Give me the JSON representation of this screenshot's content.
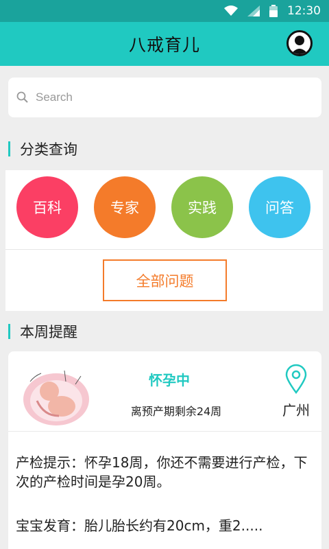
{
  "status_bar": {
    "time": "12:30"
  },
  "app_bar": {
    "title": "八戒育儿"
  },
  "search": {
    "placeholder": "Search"
  },
  "categories": {
    "header": "分类查询",
    "items": [
      {
        "label": "百科",
        "color": "#fb3f64"
      },
      {
        "label": "专家",
        "color": "#f47b2a"
      },
      {
        "label": "实践",
        "color": "#8bc34a"
      },
      {
        "label": "问答",
        "color": "#3ec3ee"
      }
    ],
    "all_button": "全部问题"
  },
  "weekly": {
    "header": "本周提醒",
    "status": "怀孕中",
    "remaining": "离预产期剩余24周",
    "city": "广州",
    "tip": "产检提示：怀孕18周，你还不需要进行产检，下次的产检时间是孕20周。",
    "growth": "宝宝发育：胎儿胎长约有20cm，重2....."
  },
  "colors": {
    "accent": "#20c9c1",
    "status_bar": "#1aa39c"
  }
}
